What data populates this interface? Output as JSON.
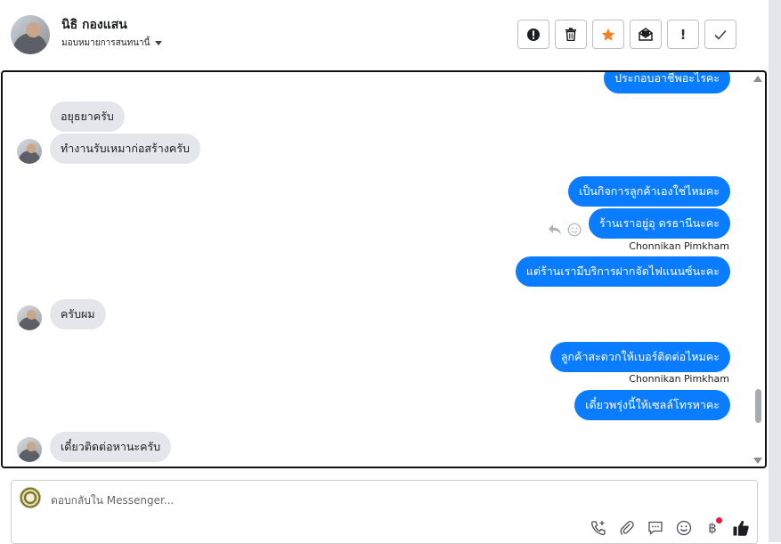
{
  "header": {
    "contact_name": "นิธิ กองแสน",
    "assign_label": "มอบหมายการสนทนานี้",
    "toolbar": [
      {
        "name": "spam-icon",
        "glyph": ""
      },
      {
        "name": "trash-icon",
        "glyph": ""
      },
      {
        "name": "star-icon",
        "glyph": ""
      },
      {
        "name": "mark-unread-icon",
        "glyph": ""
      },
      {
        "name": "follow-up-icon",
        "glyph": "!"
      },
      {
        "name": "done-check-icon",
        "glyph": ""
      }
    ]
  },
  "conversation": {
    "messages": [
      {
        "side": "out",
        "text": "ประกอบอาชีพอะไรคะ"
      },
      {
        "side": "in",
        "text": "อยุธยาครับ"
      },
      {
        "side": "in",
        "text": "ทำงานรับเหมาก่อสร้างครับ"
      },
      {
        "side": "out",
        "text": "เป็นกิจการลูกค้าเองใช่ไหมคะ"
      },
      {
        "side": "out",
        "text": "ร้านเราอยู่อุ ดรธานีนะคะ"
      },
      {
        "side": "out",
        "text": "แต่ร้านเรามีบริการฝากจัดไฟแนนซ์นะคะ"
      },
      {
        "side": "in",
        "text": "ครับผม"
      },
      {
        "side": "out",
        "text": "ลูกค้าสะดวกให้เบอร์ติดต่อไหมคะ"
      },
      {
        "side": "out",
        "text": "เดี๋ยวพรุ่งนี้ให้เซลล์โทรหาคะ"
      },
      {
        "side": "in",
        "text": "เดี๋ยวติดต่อหานะครับ"
      }
    ],
    "sender_labels": [
      "Chonnikan Pimkham",
      "Chonnikan Pimkham"
    ]
  },
  "composer": {
    "placeholder": "ตอบกลับใน Messenger...",
    "tools": [
      "call-add-icon",
      "attachment-icon",
      "saved-reply-icon",
      "emoji-icon",
      "baht-payment-icon",
      "like-icon"
    ]
  },
  "colors": {
    "outgoing_bubble": "#0a7cff",
    "incoming_bubble": "#e4e6eb",
    "star_accent": "#f5821f",
    "notification_dot": "#e41e3f"
  }
}
